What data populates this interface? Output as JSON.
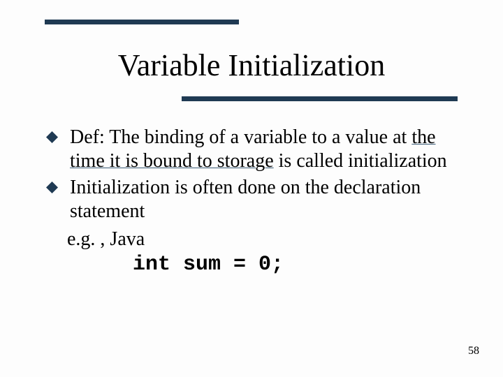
{
  "title": "Variable Initialization",
  "bullets": [
    {
      "pre": "Def: The binding of a variable to a value at ",
      "underlined": "the time it is bound to storage",
      "post": " is called initialization"
    },
    {
      "pre": "Initialization is often done on the declaration statement",
      "underlined": "",
      "post": ""
    }
  ],
  "sub": "e.g. , Java",
  "code": "int sum = 0;",
  "page": "58"
}
